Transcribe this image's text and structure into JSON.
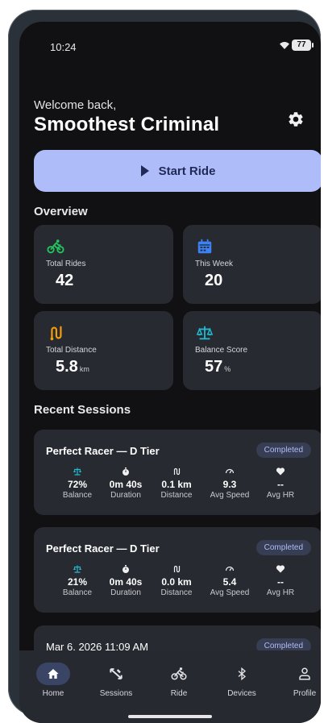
{
  "status_bar": {
    "time": "10:24",
    "battery": "77"
  },
  "header": {
    "welcome": "Welcome back,",
    "username": "Smoothest Criminal"
  },
  "start_ride_label": "Start Ride",
  "overview": {
    "title": "Overview",
    "cards": [
      {
        "label": "Total Rides",
        "value": "42",
        "unit": "",
        "icon": "bike-icon",
        "color": "#22c55e"
      },
      {
        "label": "This Week",
        "value": "20",
        "unit": "",
        "icon": "calendar-icon",
        "color": "#3b82f6"
      },
      {
        "label": "Total Distance",
        "value": "5.8",
        "unit": "km",
        "icon": "route-icon",
        "color": "#f59e0b"
      },
      {
        "label": "Balance Score",
        "value": "57",
        "unit": "%",
        "icon": "scale-icon",
        "color": "#22b8cf"
      }
    ]
  },
  "recent": {
    "title": "Recent Sessions",
    "sessions": [
      {
        "title": "Perfect Racer — D Tier",
        "status": "Completed",
        "metrics": [
          {
            "value": "72%",
            "label": "Balance"
          },
          {
            "value": "0m 40s",
            "label": "Duration"
          },
          {
            "value": "0.1 km",
            "label": "Distance"
          },
          {
            "value": "9.3",
            "label": "Avg Speed"
          },
          {
            "value": "--",
            "label": "Avg HR"
          }
        ]
      },
      {
        "title": "Perfect Racer — D Tier",
        "status": "Completed",
        "metrics": [
          {
            "value": "21%",
            "label": "Balance"
          },
          {
            "value": "0m 40s",
            "label": "Duration"
          },
          {
            "value": "0.0 km",
            "label": "Distance"
          },
          {
            "value": "5.4",
            "label": "Avg Speed"
          },
          {
            "value": "--",
            "label": "Avg HR"
          }
        ]
      },
      {
        "title": "Mar 6, 2026 11:09 AM",
        "status": "Completed"
      }
    ]
  },
  "nav": [
    {
      "label": "Home",
      "icon": "home-icon",
      "active": true
    },
    {
      "label": "Sessions",
      "icon": "sessions-icon"
    },
    {
      "label": "Ride",
      "icon": "bike-icon"
    },
    {
      "label": "Devices",
      "icon": "bluetooth-icon"
    },
    {
      "label": "Profile",
      "icon": "profile-icon"
    }
  ],
  "colors": {
    "accent": "#aebdf9",
    "card": "#272a30",
    "background": "#111113"
  }
}
